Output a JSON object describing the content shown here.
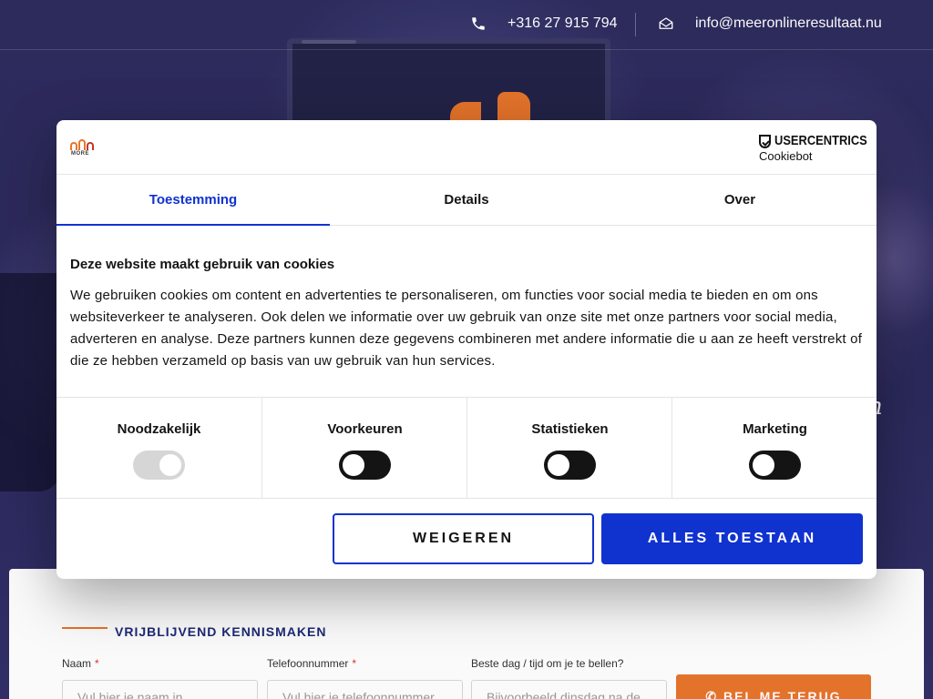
{
  "topbar": {
    "phone": "+316 27 915 794",
    "email": "info@meeronlineresultaat.nu"
  },
  "hero": {
    "script_text": "n"
  },
  "form": {
    "title": "VRIJBLIJVEND KENNISMAKEN",
    "fields": [
      {
        "label": "Naam",
        "required": "*",
        "placeholder": "Vul hier je naam in"
      },
      {
        "label": "Telefoonnummer",
        "required": "*",
        "placeholder": "Vul hier je telefoonnummer in"
      },
      {
        "label": "Beste dag / tijd om je te bellen?",
        "required": "",
        "placeholder": "Bijvoorbeeld dinsdag na de lunch"
      }
    ],
    "submit_label": "BEL ME TERUG"
  },
  "dialog": {
    "logo_text": "MORE",
    "brand": {
      "name": "USERCENTRICS",
      "sub": "Cookiebot"
    },
    "tabs": [
      {
        "label": "Toestemming",
        "active": true
      },
      {
        "label": "Details",
        "active": false
      },
      {
        "label": "Over",
        "active": false
      }
    ],
    "title": "Deze website maakt gebruik van cookies",
    "text": "We gebruiken cookies om content en advertenties te personaliseren, om functies voor social media te bieden en om ons websiteverkeer te analyseren. Ook delen we informatie over uw gebruik van onze site met onze partners voor social media, adverteren en analyse. Deze partners kunnen deze gegevens combineren met andere informatie die u aan ze heeft verstrekt of die ze hebben verzameld op basis van uw gebruik van hun services.",
    "preferences": [
      {
        "label": "Noodzakelijk",
        "state": "on",
        "disabled": true
      },
      {
        "label": "Voorkeuren",
        "state": "off",
        "disabled": false
      },
      {
        "label": "Statistieken",
        "state": "off",
        "disabled": false
      },
      {
        "label": "Marketing",
        "state": "off",
        "disabled": false
      }
    ],
    "decline_label": "WEIGEREN",
    "accept_label": "ALLES TOESTAAN"
  },
  "colors": {
    "accent_blue": "#1032cf",
    "brand_orange": "#e8762b",
    "hero_bg": "#2c2a5c"
  }
}
